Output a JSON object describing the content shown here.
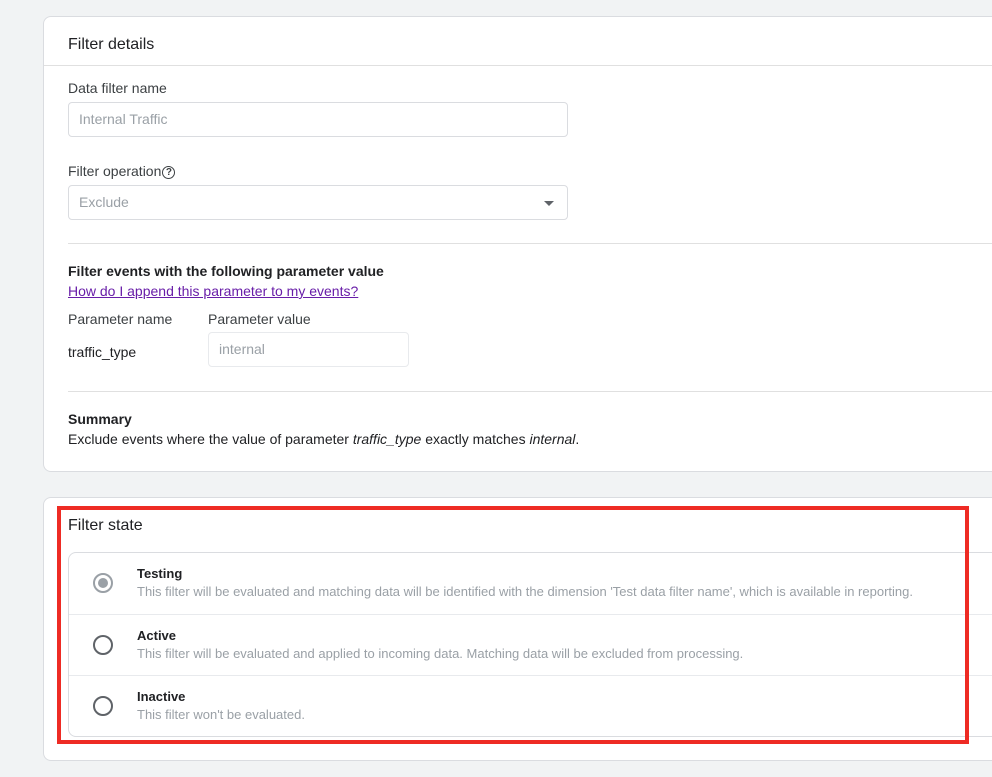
{
  "details": {
    "title": "Filter details",
    "name_label": "Data filter name",
    "name_value": "Internal Traffic",
    "operation_label": "Filter operation",
    "operation_help_icon": "help-circle-icon",
    "operation_value": "Exclude",
    "params_heading": "Filter events with the following parameter value",
    "help_link": "How do I append this parameter to my events?",
    "param_name_header": "Parameter name",
    "param_value_header": "Parameter value",
    "param_name": "traffic_type",
    "param_value": "internal",
    "summary_heading": "Summary",
    "summary_prefix": "Exclude events where the value of parameter ",
    "summary_param": "traffic_type",
    "summary_middle": " exactly matches ",
    "summary_value": "internal",
    "summary_suffix": "."
  },
  "state": {
    "title": "Filter state",
    "selected": "Testing",
    "options": [
      {
        "label": "Testing",
        "description": "This filter will be evaluated and matching data will be identified with the dimension 'Test data filter name', which is available in reporting."
      },
      {
        "label": "Active",
        "description": "This filter will be evaluated and applied to incoming data. Matching data will be excluded from processing."
      },
      {
        "label": "Inactive",
        "description": "This filter won't be evaluated."
      }
    ]
  },
  "colors": {
    "highlight": "#ee2b24",
    "link": "#681da8"
  }
}
